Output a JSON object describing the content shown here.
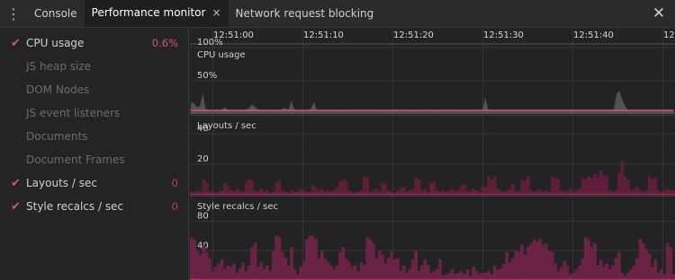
{
  "tabs": [
    {
      "label": "Console"
    },
    {
      "label": "Performance monitor",
      "close": "×"
    },
    {
      "label": "Network request blocking"
    }
  ],
  "close_panel": "✕",
  "metrics": [
    {
      "label": "CPU usage",
      "value": "0.6%",
      "checked": true,
      "color": "#d1557a"
    },
    {
      "label": "JS heap size",
      "value": "",
      "checked": false
    },
    {
      "label": "DOM Nodes",
      "value": "",
      "checked": false
    },
    {
      "label": "JS event listeners",
      "value": "",
      "checked": false
    },
    {
      "label": "Documents",
      "value": "",
      "checked": false
    },
    {
      "label": "Document Frames",
      "value": "",
      "checked": false
    },
    {
      "label": "Layouts / sec",
      "value": "0",
      "checked": true,
      "color": "#b83a5f"
    },
    {
      "label": "Style recalcs / sec",
      "value": "0",
      "checked": true,
      "color": "#b83a5f"
    }
  ],
  "time_ticks": [
    "12:51:00",
    "12:51:10",
    "12:51:20",
    "12:51:30",
    "12:51:40",
    "12:51:5"
  ],
  "panes": {
    "cpu": {
      "title": "CPU usage",
      "gridlines": [
        "100%",
        "50%"
      ]
    },
    "layouts": {
      "title": "Layouts / sec",
      "gridlines": [
        "40",
        "20"
      ]
    },
    "style": {
      "title": "Style recalcs / sec",
      "gridlines": [
        "80",
        "40"
      ]
    }
  },
  "chart_data": [
    {
      "type": "area",
      "title": "CPU usage",
      "ylim": [
        0,
        100
      ],
      "series": [
        {
          "name": "CPU usage",
          "values": [
            18,
            16,
            10,
            12,
            30,
            8,
            5,
            4,
            5,
            6,
            4,
            8,
            10,
            6,
            5,
            5,
            4,
            6,
            5,
            7,
            8,
            14,
            12,
            8,
            6,
            5,
            7,
            5,
            4,
            5,
            6,
            5,
            8,
            9,
            6,
            20,
            8,
            5,
            4,
            5,
            4,
            5,
            9,
            18,
            6,
            5,
            4,
            5,
            5,
            6,
            5,
            4,
            6,
            5,
            5,
            4,
            5,
            4,
            5,
            5,
            4,
            5,
            6,
            4,
            5,
            5,
            4,
            6,
            5,
            5,
            6,
            4,
            5,
            5,
            4,
            6,
            4,
            5,
            5,
            6,
            4,
            5,
            5,
            4,
            5,
            5,
            6,
            4,
            5,
            5,
            4,
            5,
            6,
            4,
            5,
            5,
            6,
            5,
            4,
            5,
            4,
            5,
            5,
            25,
            8,
            5,
            4,
            5,
            4,
            5,
            4,
            5,
            6,
            5,
            4,
            5,
            5,
            4,
            5,
            5,
            4,
            5,
            5,
            6,
            4,
            5,
            5,
            4,
            5,
            5,
            4,
            5,
            5,
            6,
            5,
            4,
            5,
            5,
            6,
            5,
            4,
            5,
            5,
            6,
            5,
            4,
            5,
            5,
            4,
            30,
            35,
            22,
            12,
            6,
            5,
            4,
            5,
            5,
            6,
            5,
            4,
            5,
            5,
            4,
            5,
            4,
            5,
            5,
            4,
            5
          ]
        }
      ]
    },
    {
      "type": "bar",
      "title": "Layouts / sec",
      "ylim": [
        0,
        50
      ],
      "series": [
        {
          "name": "Layouts / sec",
          "values": [
            2,
            1,
            3,
            2,
            10,
            8,
            2,
            3,
            1,
            2,
            3,
            8,
            6,
            3,
            2,
            4,
            3,
            2,
            8,
            10,
            9,
            3,
            2,
            4,
            2,
            3,
            1,
            2,
            8,
            9,
            3,
            2,
            1,
            3,
            2,
            2,
            4,
            3,
            2,
            2,
            6,
            5,
            3,
            4,
            2,
            3,
            2,
            3,
            5,
            9,
            10,
            9,
            3,
            2,
            1,
            2,
            3,
            12,
            11,
            2,
            3,
            4,
            2,
            8,
            7,
            3,
            2,
            1,
            3,
            4,
            5,
            2,
            3,
            4,
            11,
            10,
            3,
            4,
            2,
            8,
            9,
            3,
            2,
            3,
            2,
            3,
            4,
            2,
            3,
            6,
            7,
            3,
            2,
            4,
            3,
            2,
            6,
            5,
            12,
            10,
            12,
            4,
            3,
            2,
            3,
            4,
            7,
            2,
            3,
            10,
            9,
            12,
            3,
            2,
            3,
            4,
            2,
            3,
            2,
            12,
            11,
            10,
            3,
            2,
            3,
            4,
            2,
            3,
            4,
            11,
            10,
            12,
            11,
            14,
            12,
            16,
            13,
            12,
            3,
            2,
            3,
            14,
            22,
            12,
            10,
            3,
            4,
            5,
            3,
            2,
            3,
            12,
            10,
            11,
            3,
            2,
            3,
            4,
            3,
            3
          ]
        }
      ]
    },
    {
      "type": "bar",
      "title": "Style recalcs / sec",
      "ylim": [
        0,
        110
      ],
      "series": [
        {
          "name": "Style recalcs / sec",
          "values": [
            58,
            55,
            40,
            35,
            48,
            38,
            30,
            12,
            18,
            22,
            28,
            15,
            20,
            18,
            22,
            10,
            16,
            24,
            12,
            20,
            45,
            50,
            18,
            24,
            15,
            20,
            12,
            40,
            60,
            58,
            38,
            30,
            20,
            45,
            15,
            8,
            18,
            25,
            55,
            60,
            60,
            56,
            30,
            40,
            30,
            25,
            20,
            15,
            20,
            38,
            45,
            30,
            25,
            18,
            20,
            12,
            24,
            20,
            58,
            55,
            50,
            30,
            40,
            35,
            22,
            30,
            38,
            28,
            30,
            12,
            20,
            10,
            15,
            28,
            40,
            12,
            20,
            28,
            20,
            10,
            12,
            15,
            28,
            6,
            8,
            10,
            15,
            8,
            10,
            12,
            8,
            14,
            6,
            18,
            12,
            8,
            10,
            10,
            12,
            8,
            20,
            14,
            16,
            22,
            38,
            24,
            30,
            40,
            38,
            48,
            35,
            46,
            50,
            55,
            52,
            56,
            48,
            50,
            40,
            38,
            22,
            12,
            18,
            26,
            20,
            8,
            10,
            14,
            20,
            30,
            58,
            55,
            45,
            50,
            20,
            28,
            18,
            22,
            15,
            20,
            30,
            38,
            10,
            6,
            10,
            15,
            20,
            30,
            56,
            50,
            42,
            36,
            18,
            28,
            10,
            15,
            8,
            50,
            45,
            8
          ]
        }
      ]
    }
  ]
}
